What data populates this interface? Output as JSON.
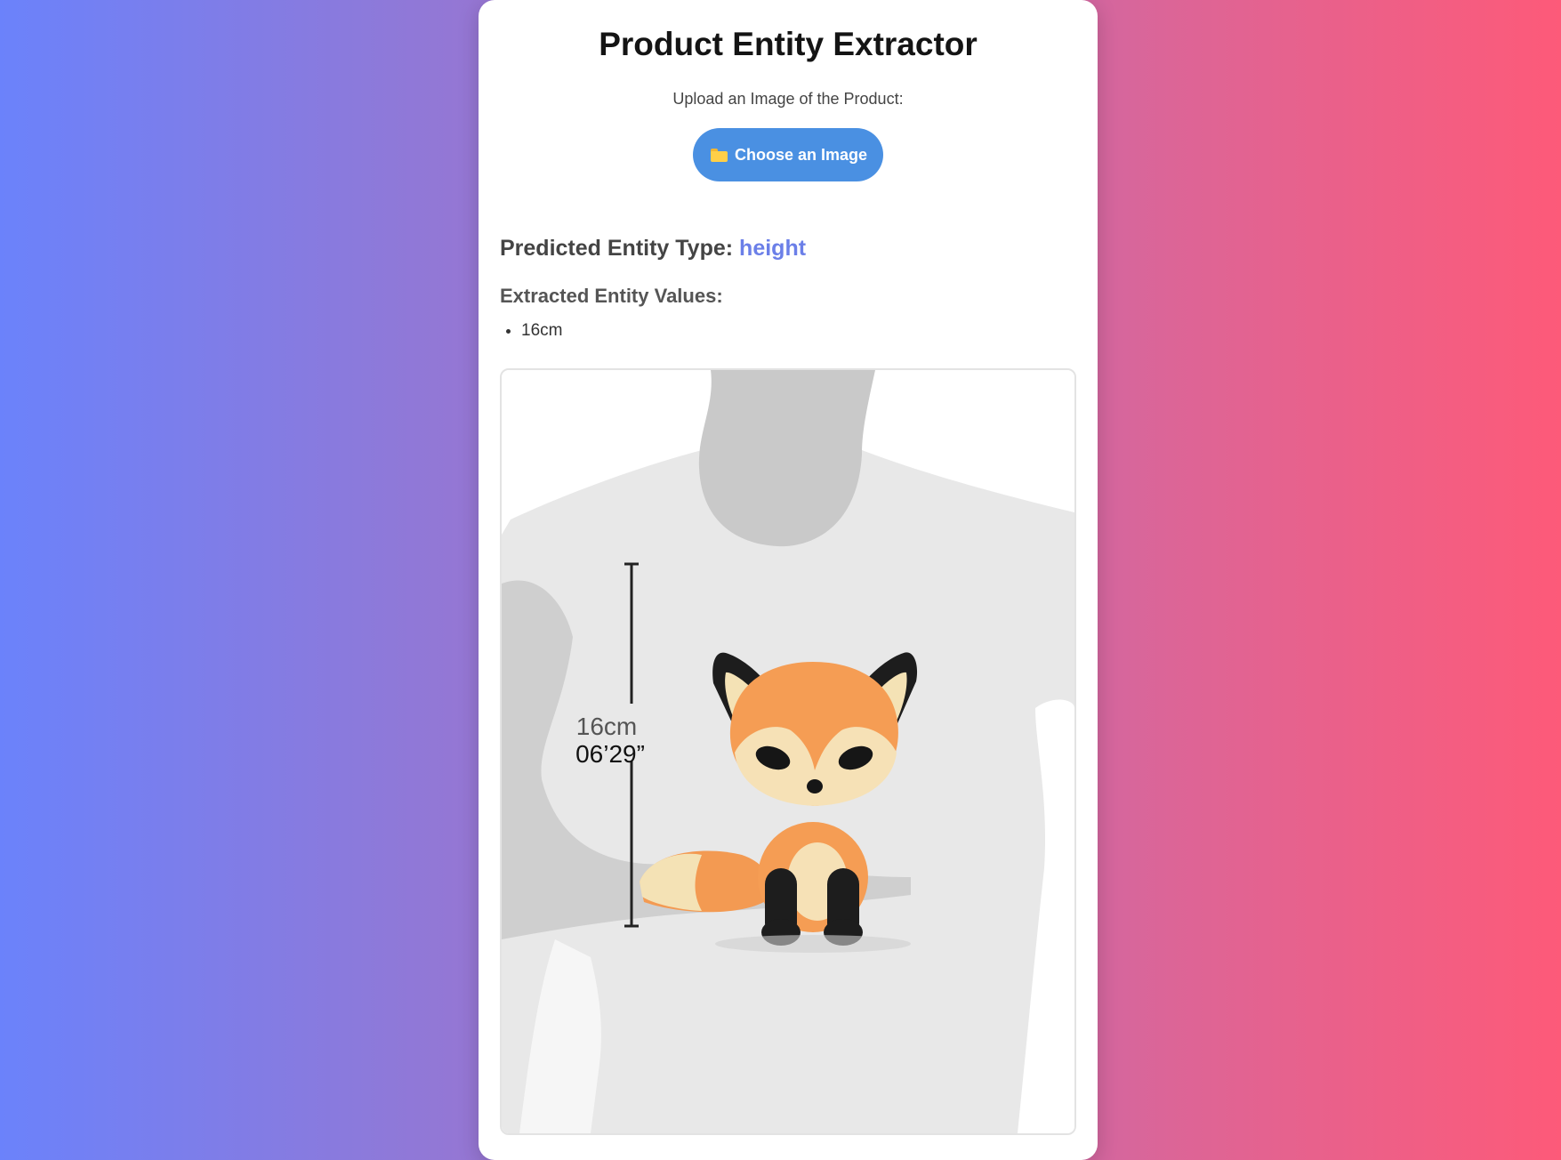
{
  "app": {
    "title": "Product Entity Extractor",
    "upload_label": "Upload an Image of the Product:",
    "choose_button": "Choose an Image"
  },
  "result": {
    "predicted_label": "Predicted Entity Type:",
    "predicted_value": "height",
    "extracted_label": "Extracted Entity Values:",
    "values": [
      "16cm"
    ]
  },
  "product_image": {
    "measure_cm": "16cm",
    "measure_in": "06’29”"
  },
  "colors": {
    "button": "#4a90e2",
    "accent": "#6b7fe8",
    "gradient_start": "#6b82fb",
    "gradient_end": "#fd5a79"
  },
  "icons": {
    "button_icon": "folder-icon"
  }
}
